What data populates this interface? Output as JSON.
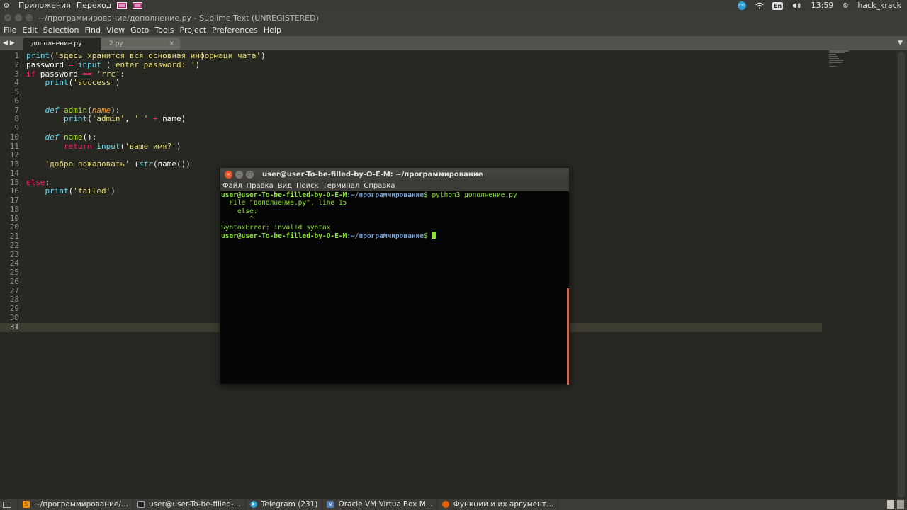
{
  "top_panel": {
    "apps_label": "Приложения",
    "places_label": "Переход",
    "time": "13:59",
    "username": "hack_krack",
    "keyboard_layout": "En",
    "telegram_badge": "231"
  },
  "window": {
    "title": "~/программирование/дополнение.py - Sublime Text (UNREGISTERED)"
  },
  "menu": [
    "File",
    "Edit",
    "Selection",
    "Find",
    "View",
    "Goto",
    "Tools",
    "Project",
    "Preferences",
    "Help"
  ],
  "tabs": [
    {
      "label": "дополнение.py",
      "active": true
    },
    {
      "label": "2.py",
      "active": false
    }
  ],
  "editor": {
    "line_count": 31,
    "active_line": 31
  },
  "terminal": {
    "title": "user@user-To-be-filled-by-O-E-M: ~/программирование",
    "menu": [
      "Файл",
      "Правка",
      "Вид",
      "Поиск",
      "Терминал",
      "Справка"
    ],
    "prompt_user": "user@user-To-be-filled-by-O-E-M",
    "prompt_path": ":~/программирование",
    "prompt_symbol": "$",
    "command": " python3 дополнение.py",
    "output": [
      "  File \"дополнение.py\", line 15",
      "    else:",
      "       ^",
      "SyntaxError: invalid syntax"
    ]
  },
  "taskbar": [
    {
      "label": "~/программирование/...",
      "icon": "sublime-icon"
    },
    {
      "label": "user@user-To-be-filled-...",
      "icon": "terminal-icon"
    },
    {
      "label": "Telegram (231)",
      "icon": "telegram-icon"
    },
    {
      "label": "Oracle VM VirtualBox M...",
      "icon": "virtualbox-icon"
    },
    {
      "label": "Функции и их аргумент...",
      "icon": "firefox-icon"
    }
  ],
  "colors": {
    "editor_bg": "#272822",
    "keyword": "#f92672",
    "string": "#e6db74",
    "builtin": "#66d9ef",
    "function": "#a6e22e",
    "terminal_green": "#8ae234",
    "terminal_blue": "#729fcf"
  }
}
